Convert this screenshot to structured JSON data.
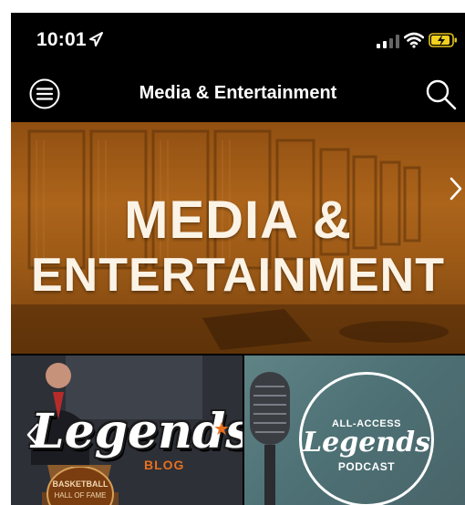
{
  "status_bar": {
    "time": "10:01"
  },
  "nav": {
    "title": "Media & Entertainment",
    "menu_icon": "menu-circle-icon",
    "search_icon": "search-icon"
  },
  "hero": {
    "line1": "MEDIA &",
    "line2": "ENTERTAINMENT"
  },
  "tiles": {
    "blog": {
      "word": "Legends",
      "sub": "BLOG",
      "seal": "BASKETBALL HALL OF FAME"
    },
    "podcast": {
      "top": "ALL-ACCESS",
      "word": "Legends",
      "sub": "PODCAST"
    }
  },
  "colors": {
    "accent": "#e8701e",
    "nav_bg": "#000000",
    "hero_tint": "#b0661c"
  }
}
